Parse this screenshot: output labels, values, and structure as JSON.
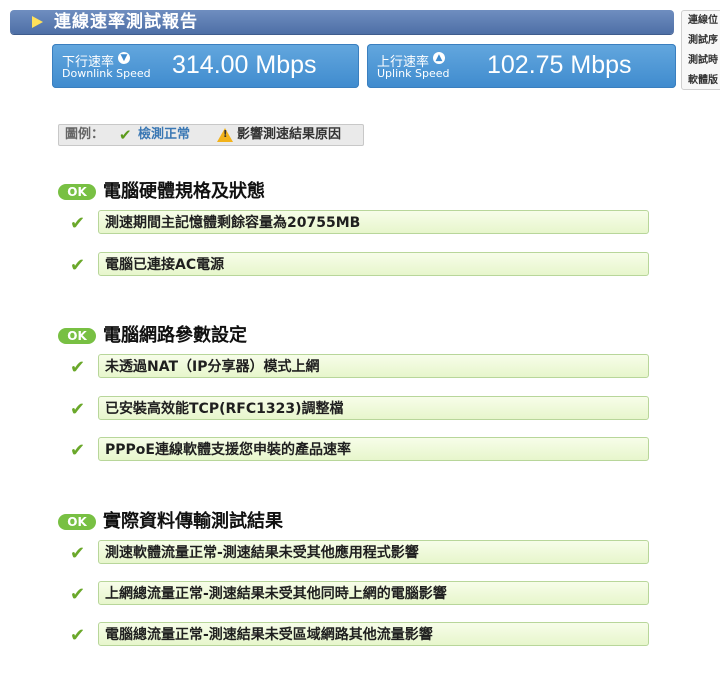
{
  "header": {
    "title": "連線速率測試報告"
  },
  "info_panel": {
    "items": [
      "連線位",
      "測試序",
      "測試時",
      "軟體版"
    ]
  },
  "downlink": {
    "label_cn": "下行速率",
    "label_en": "Downlink Speed",
    "value": "314.00 Mbps"
  },
  "uplink": {
    "label_cn": "上行速率",
    "label_en": "Uplink Speed",
    "value": "102.75 Mbps"
  },
  "legend": {
    "label": "圖例：",
    "ok_text": "檢測正常",
    "warn_text": "影響測速結果原因"
  },
  "sections": [
    {
      "badge": "OK",
      "title": "電腦硬體規格及狀態",
      "items": [
        "測速期間主記憶體剩餘容量為20755MB",
        "電腦已連接AC電源"
      ]
    },
    {
      "badge": "OK",
      "title": "電腦網路參數設定",
      "items": [
        "未透過NAT（IP分享器）模式上網",
        "已安裝高效能TCP(RFC1323)調整檔",
        "PPPoE連線軟體支援您申裝的產品速率"
      ]
    },
    {
      "badge": "OK",
      "title": "實際資料傳輸測試結果",
      "items": [
        "測速軟體流量正常-測速結果未受其他應用程式影響",
        "上網總流量正常-測速結果未受其他同時上網的電腦影響",
        "電腦總流量正常-測速結果未受區域網路其他流量影響"
      ]
    }
  ],
  "colors": {
    "header": "#5a7bb2",
    "speed_box": "#4f98d6",
    "ok_badge": "#78c043",
    "row_bg": "#eef9da",
    "check": "#6aa82a"
  }
}
